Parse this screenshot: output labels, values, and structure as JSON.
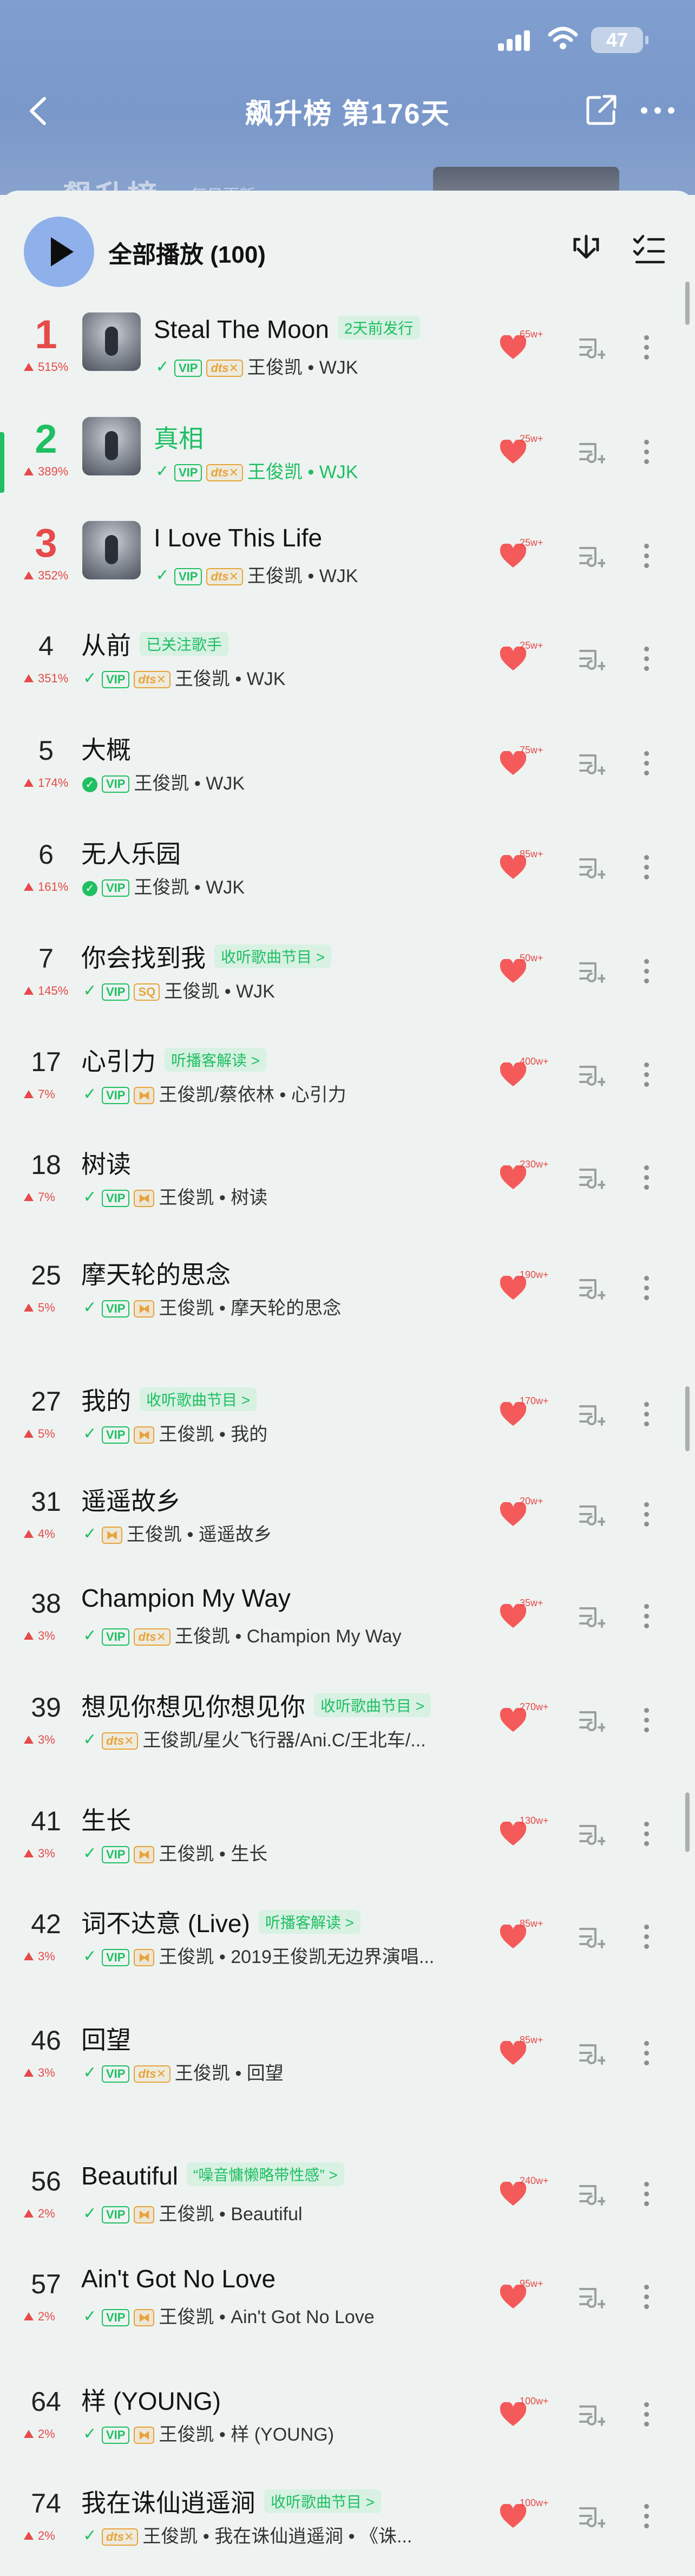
{
  "status": {
    "battery": "47"
  },
  "header": {
    "title": "飙升榜 第176天",
    "banner_text": "飙升榜",
    "banner_sub": "每日更新"
  },
  "play_all": {
    "label": "全部播放 (100)"
  },
  "colors": {
    "accent_green": "#1fbf62",
    "rank_top_red": "#e64a4a",
    "header_blue": "#7f9fd0"
  },
  "songs": [
    {
      "rank": "1",
      "trend": "515%",
      "title": "Steal The Moon",
      "tag": "2天前发行",
      "badges": [
        "hollow-check",
        "vip",
        "dts"
      ],
      "artists": "王俊凯 • WJK",
      "likes": "65w+"
    },
    {
      "rank": "2",
      "trend": "389%",
      "title": "真相",
      "tag": "",
      "badges": [
        "hollow-check",
        "vip",
        "dts"
      ],
      "artists": "王俊凯 • WJK",
      "likes": "25w+"
    },
    {
      "rank": "3",
      "trend": "352%",
      "title": "I Love This Life",
      "tag": "",
      "badges": [
        "hollow-check",
        "vip",
        "dts"
      ],
      "artists": "王俊凯 • WJK",
      "likes": "25w+"
    },
    {
      "rank": "4",
      "trend": "351%",
      "title": "从前",
      "tag": "已关注歌手",
      "badges": [
        "hollow-check",
        "vip",
        "dts"
      ],
      "artists": "王俊凯 • WJK",
      "likes": "25w+"
    },
    {
      "rank": "5",
      "trend": "174%",
      "title": "大概",
      "tag": "",
      "badges": [
        "check",
        "vip"
      ],
      "artists": "王俊凯 • WJK",
      "likes": "75w+"
    },
    {
      "rank": "6",
      "trend": "161%",
      "title": "无人乐园",
      "tag": "",
      "badges": [
        "check",
        "vip"
      ],
      "artists": "王俊凯 • WJK",
      "likes": "85w+"
    },
    {
      "rank": "7",
      "trend": "145%",
      "title": "你会找到我",
      "tag": "收听歌曲节目 >",
      "badges": [
        "hollow-check",
        "vip",
        "sq"
      ],
      "artists": "王俊凯 • WJK",
      "likes": "50w+"
    },
    {
      "rank": "17",
      "trend": "7%",
      "title": "心引力",
      "tag": "听播客解读 >",
      "badges": [
        "hollow-check",
        "vip",
        "hr"
      ],
      "artists": "王俊凯/蔡依林 • 心引力",
      "likes": "400w+"
    },
    {
      "rank": "18",
      "trend": "7%",
      "title": "树读",
      "tag": "",
      "badges": [
        "hollow-check",
        "vip",
        "hr"
      ],
      "artists": "王俊凯 • 树读",
      "likes": "230w+"
    },
    {
      "rank": "25",
      "trend": "5%",
      "title": "摩天轮的思念",
      "tag": "",
      "badges": [
        "hollow-check",
        "vip",
        "hr"
      ],
      "artists": "王俊凯 • 摩天轮的思念",
      "likes": "190w+"
    },
    {
      "rank": "27",
      "trend": "5%",
      "title": "我的",
      "tag": "收听歌曲节目 >",
      "badges": [
        "hollow-check",
        "vip",
        "hr"
      ],
      "artists": "王俊凯 • 我的",
      "likes": "170w+"
    },
    {
      "rank": "31",
      "trend": "4%",
      "title": "遥遥故乡",
      "tag": "",
      "badges": [
        "hollow-check",
        "hr"
      ],
      "artists": "王俊凯 • 遥遥故乡",
      "likes": "20w+"
    },
    {
      "rank": "38",
      "trend": "3%",
      "title": "Champion My Way",
      "tag": "",
      "badges": [
        "hollow-check",
        "vip",
        "dts"
      ],
      "artists": "王俊凯 • Champion My Way",
      "likes": "35w+"
    },
    {
      "rank": "39",
      "trend": "3%",
      "title": "想见你想见你想见你",
      "tag": "收听歌曲节目 >",
      "badges": [
        "hollow-check",
        "dts"
      ],
      "artists": "王俊凯/星火飞行器/Ani.C/王北车/...",
      "likes": "270w+"
    },
    {
      "rank": "41",
      "trend": "3%",
      "title": "生长",
      "tag": "",
      "badges": [
        "hollow-check",
        "vip",
        "hr"
      ],
      "artists": "王俊凯 • 生长",
      "likes": "130w+"
    },
    {
      "rank": "42",
      "trend": "3%",
      "title": "词不达意 (Live)",
      "tag": "听播客解读 >",
      "badges": [
        "hollow-check",
        "vip",
        "hr"
      ],
      "artists": "王俊凯 • 2019王俊凯无边界演唱...",
      "likes": "85w+"
    },
    {
      "rank": "46",
      "trend": "3%",
      "title": "回望",
      "tag": "",
      "badges": [
        "hollow-check",
        "vip",
        "dts"
      ],
      "artists": "王俊凯 • 回望",
      "likes": "85w+"
    },
    {
      "rank": "56",
      "trend": "2%",
      "title": "Beautiful",
      "tag": "“噪音慵懒略带性感” >",
      "badges": [
        "hollow-check",
        "vip",
        "hr"
      ],
      "artists": "王俊凯 • Beautiful",
      "likes": "240w+"
    },
    {
      "rank": "57",
      "trend": "2%",
      "title": "Ain't Got No Love",
      "tag": "",
      "badges": [
        "hollow-check",
        "vip",
        "hr"
      ],
      "artists": "王俊凯 • Ain't Got No Love",
      "likes": "95w+"
    },
    {
      "rank": "64",
      "trend": "2%",
      "title": "样 (YOUNG)",
      "tag": "",
      "badges": [
        "hollow-check",
        "vip",
        "hr"
      ],
      "artists": "王俊凯 • 样 (YOUNG)",
      "likes": "100w+"
    },
    {
      "rank": "74",
      "trend": "2%",
      "title": "我在诛仙逍遥涧",
      "tag": "收听歌曲节目 >",
      "badges": [
        "hollow-check",
        "dts"
      ],
      "artists": "王俊凯 • 我在诛仙逍遥涧 • 《诛...",
      "likes": "100w+"
    }
  ]
}
